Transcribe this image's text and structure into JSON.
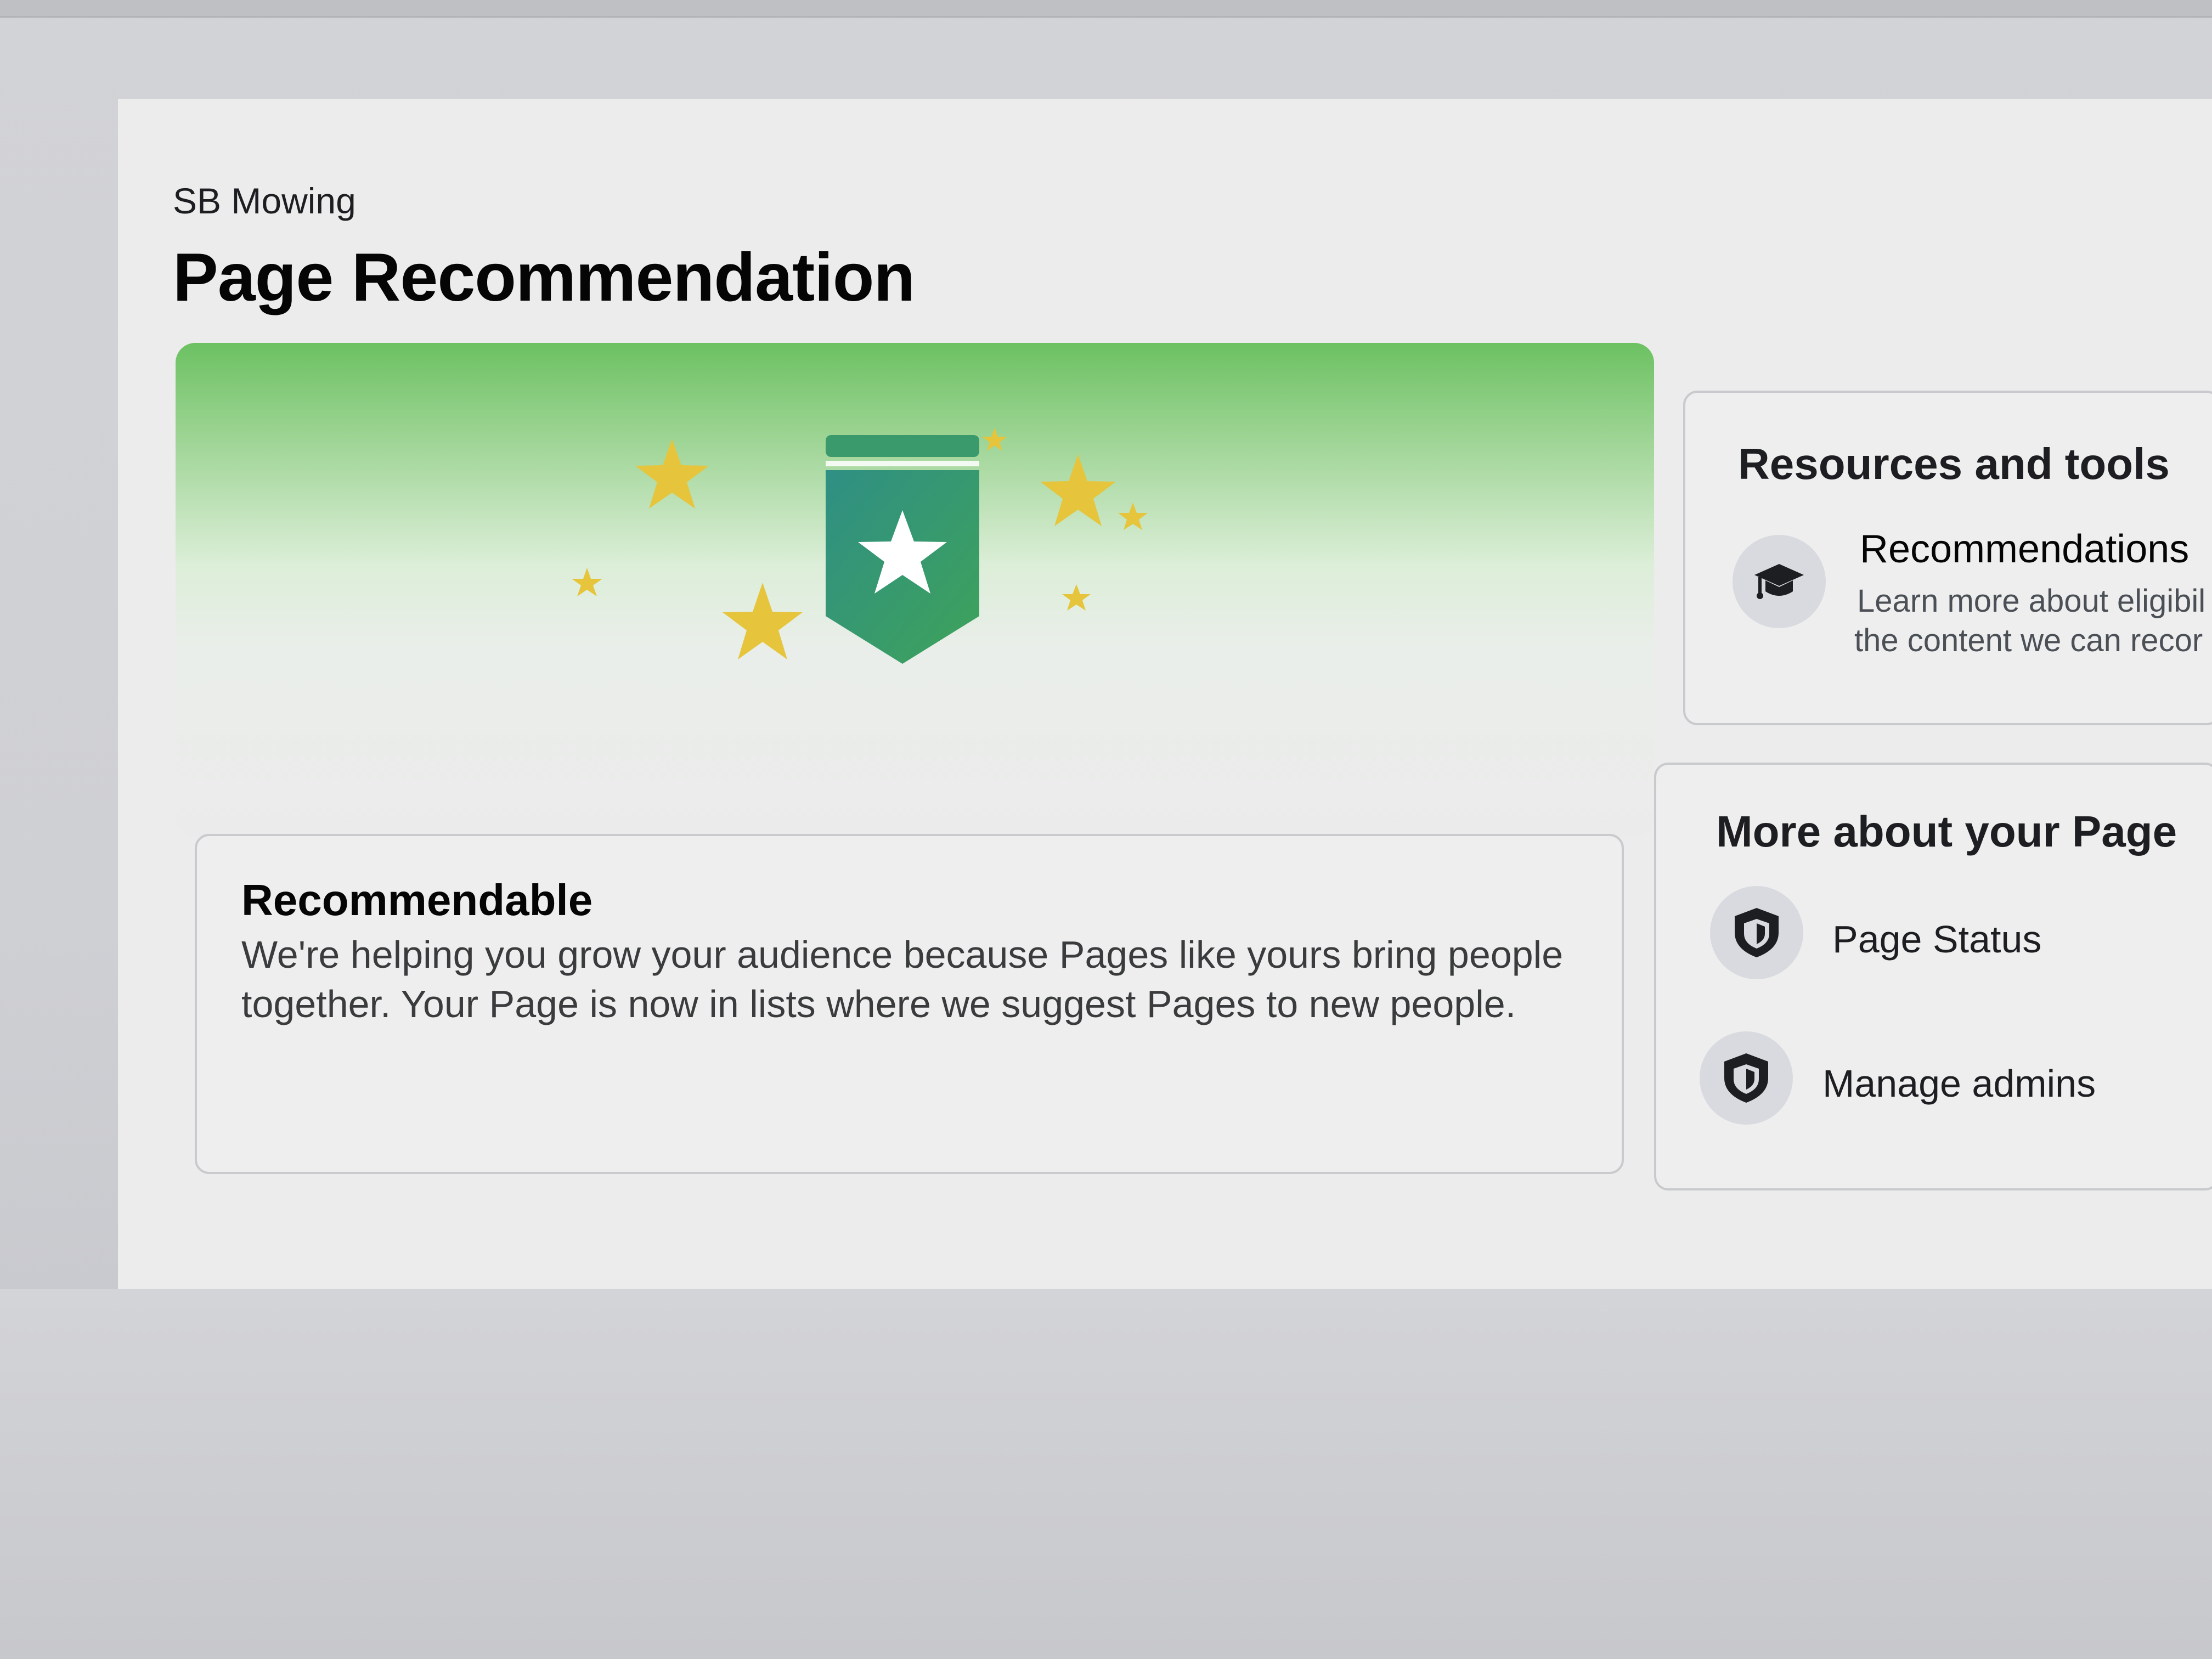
{
  "header": {
    "page_name": "SB Mowing",
    "title": "Page Recommendation"
  },
  "status_card": {
    "title": "Recommendable",
    "description": "We're helping you grow your audience because Pages like yours bring people together. Your Page is now in lists where we suggest Pages to new people."
  },
  "resources": {
    "title": "Resources and tools",
    "items": [
      {
        "title": "Recommendations",
        "desc_line1": "Learn more about eligibil",
        "desc_line2": "the content we can recor",
        "icon": "graduation-cap-icon"
      }
    ]
  },
  "more_about": {
    "title": "More about your Page",
    "items": [
      {
        "label": "Page Status",
        "icon": "shield-icon"
      },
      {
        "label": "Manage admins",
        "icon": "shield-icon"
      }
    ]
  },
  "colors": {
    "hero_green": "#6cc162",
    "badge_teal": "#2f8f84",
    "badge_green": "#3ea35a",
    "star_gold": "#e6c53c"
  }
}
